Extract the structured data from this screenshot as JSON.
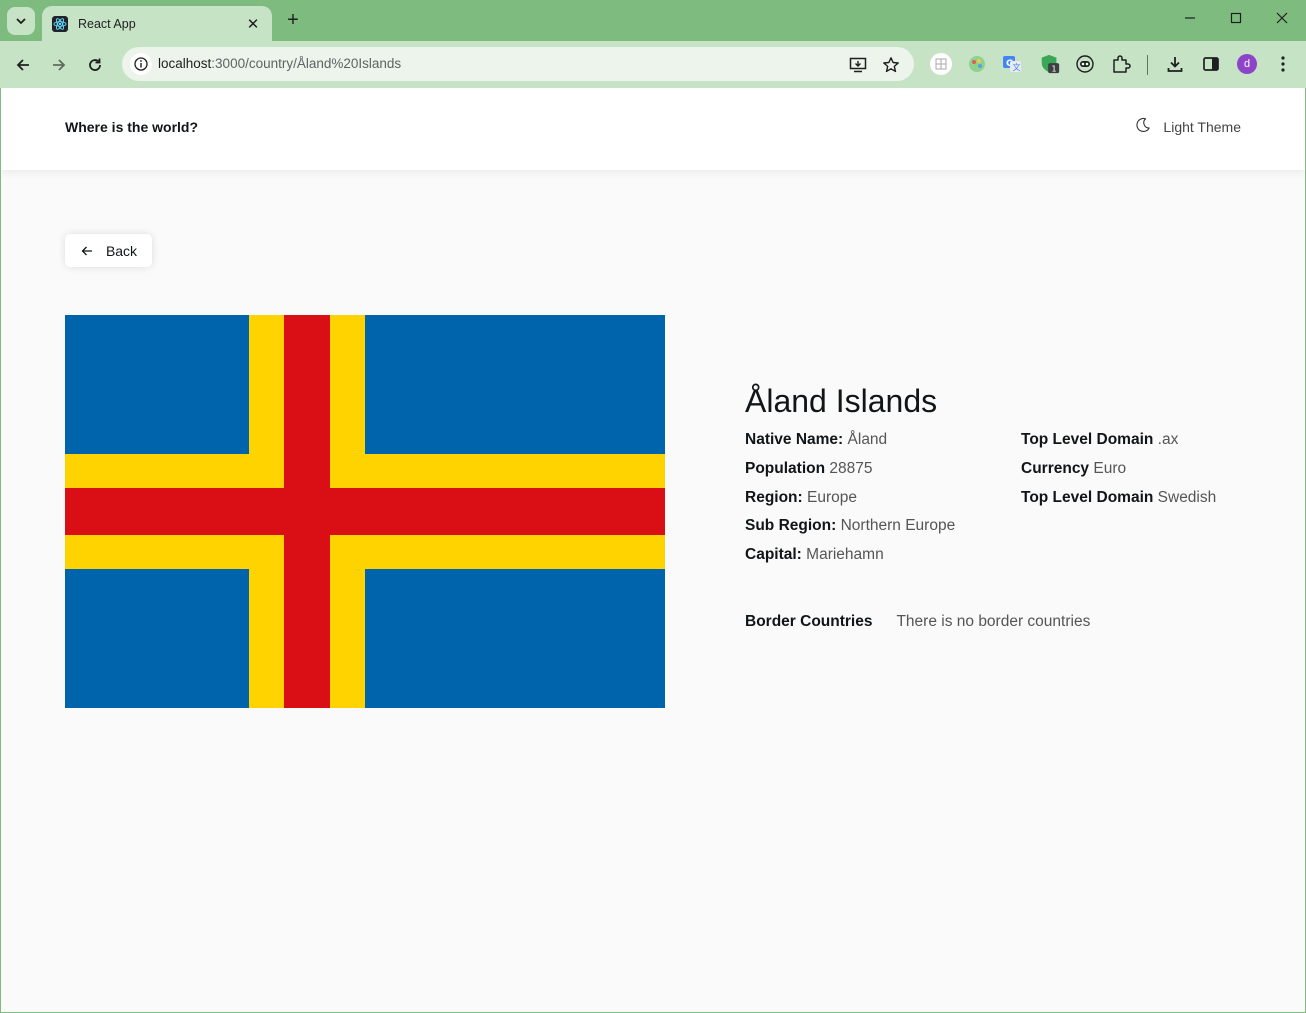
{
  "browser": {
    "tab_title": "React App",
    "url_host": "localhost",
    "url_path": ":3000/country/Åland%20Islands",
    "avatar_letter": "d",
    "ext_badge": "1",
    "accent": "#7dbb7f"
  },
  "header": {
    "brand": "Where is the world?",
    "theme_label": "Light Theme"
  },
  "back_label": "Back",
  "country": {
    "name": "Åland Islands",
    "flag_colors": {
      "blue": "#0064ad",
      "yellow": "#ffd300",
      "red": "#da0e15"
    },
    "col1": [
      {
        "key": "Native Name:",
        "value": "Åland"
      },
      {
        "key": "Population",
        "value": "28875"
      },
      {
        "key": "Region:",
        "value": "Europe"
      },
      {
        "key": "Sub Region:",
        "value": "Northern Europe"
      },
      {
        "key": "Capital:",
        "value": "Mariehamn"
      }
    ],
    "col2": [
      {
        "key": "Top Level Domain",
        "value": ".ax"
      },
      {
        "key": "Currency",
        "value": "Euro"
      },
      {
        "key": "Top Level Domain",
        "value": "Swedish"
      }
    ],
    "border_label": "Border Countries",
    "border_value": "There is no border countries"
  }
}
